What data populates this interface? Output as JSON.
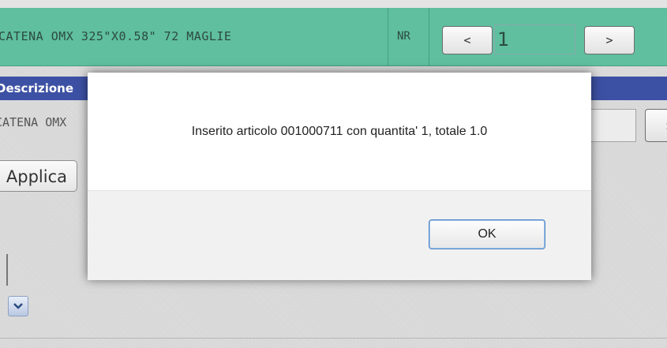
{
  "header": {
    "article_description": "CATENA OMX 325\"X0.58\" 72 MAGLIE",
    "nr_label": "NR",
    "prev_label": "<",
    "next_label": ">",
    "nr_value": "1"
  },
  "section": {
    "label": "Descrizione"
  },
  "form": {
    "description_value": "CATENA OMX",
    "right_button_label": ">",
    "applica_label": "Applica"
  },
  "dialog": {
    "message": "Inserito articolo 001000711 con quantita' 1, totale 1.0",
    "ok_label": "OK"
  },
  "icons": [
    "chevron-down-icon"
  ],
  "colors": {
    "header_bg": "#5fbf9f",
    "section_bg": "#3d51a4",
    "ok_focus_border": "#4f86c6"
  }
}
